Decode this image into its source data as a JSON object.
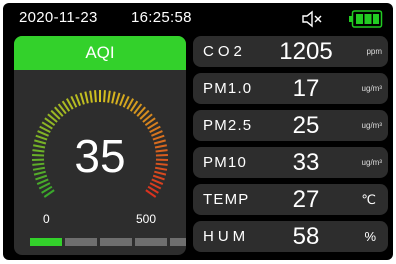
{
  "status_bar": {
    "date": "2020-11-23",
    "time": "16:25:58",
    "sound_icon": "speaker-muted-icon",
    "battery_icon": "battery-full-icon",
    "battery_color": "#22cc22"
  },
  "aqi": {
    "title": "AQI",
    "value": "35",
    "gauge_min": "0",
    "gauge_max": "500",
    "level_segments": 5,
    "active_segment": 1,
    "header_color": "#33d12b"
  },
  "metrics": [
    {
      "label": "CO2",
      "value": "1205",
      "unit": "ppm"
    },
    {
      "label": "PM1.0",
      "value": "17",
      "unit": "ug/m³"
    },
    {
      "label": "PM2.5",
      "value": "25",
      "unit": "ug/m³"
    },
    {
      "label": "PM10",
      "value": "33",
      "unit": "ug/m³"
    },
    {
      "label": "TEMP",
      "value": "27",
      "unit": "℃"
    },
    {
      "label": "HUM",
      "value": "58",
      "unit": "%"
    }
  ]
}
